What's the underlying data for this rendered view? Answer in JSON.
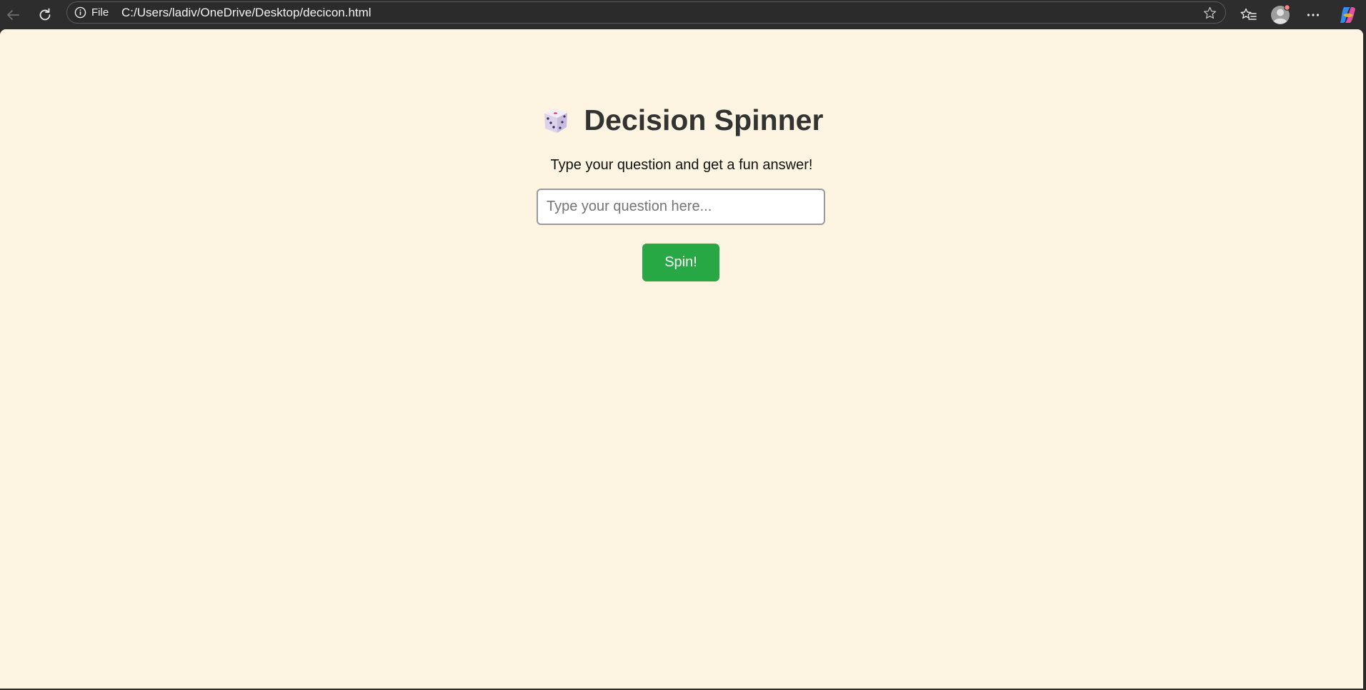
{
  "browser": {
    "site_info_label": "File",
    "url": "C:/Users/ladiv/OneDrive/Desktop/decicon.html",
    "icons": {
      "back": "back-arrow-icon",
      "refresh": "refresh-icon",
      "info": "info-icon",
      "favorite": "star-icon",
      "favorites": "favorites-list-icon",
      "profile": "profile-avatar-icon",
      "more": "more-options-icon",
      "copilot": "copilot-icon"
    }
  },
  "page": {
    "title_emoji": "🎲",
    "title": "Decision Spinner",
    "subtitle": "Type your question and get a fun answer!",
    "question_input": {
      "value": "",
      "placeholder": "Type your question here..."
    },
    "spin_button_label": "Spin!",
    "colors": {
      "background": "#fdf5e2",
      "button": "#28a745",
      "title": "#333333"
    }
  }
}
